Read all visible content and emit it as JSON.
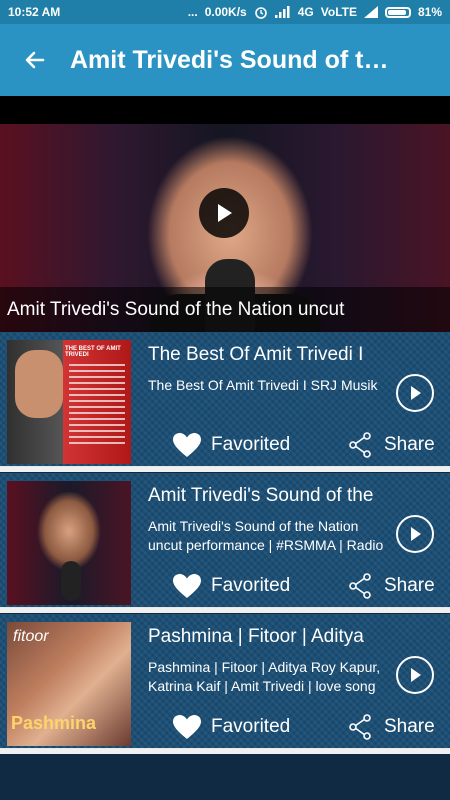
{
  "status": {
    "time": "10:52 AM",
    "dots": "...",
    "speed": "0.00K/s",
    "network": "4G",
    "volte": "VoLTE",
    "battery": "81%",
    "battery_level": 0.81
  },
  "appbar": {
    "title": "Amit Trivedi's Sound of the Nation uncut"
  },
  "hero": {
    "caption": "Amit Trivedi's Sound of the Nation uncut"
  },
  "cards": [
    {
      "title": "The Best Of Amit Trivedi I",
      "desc": "The Best Of Amit Trivedi I SRJ Musik",
      "fav": "Favorited",
      "share": "Share",
      "thumb_header": "THE BEST OF AMIT TRIVEDI"
    },
    {
      "title": "Amit Trivedi's Sound of the",
      "desc": "Amit Trivedi's Sound of the Nation uncut performance | #RSMMA | Radio",
      "fav": "Favorited",
      "share": "Share"
    },
    {
      "title": "Pashmina | Fitoor | Aditya",
      "desc": "Pashmina | Fitoor | Aditya Roy Kapur, Katrina Kaif | Amit Trivedi | love song",
      "fav": "Favorited",
      "share": "Share",
      "thumb_logo": "fitoor",
      "thumb_name": "Pashmina"
    }
  ]
}
